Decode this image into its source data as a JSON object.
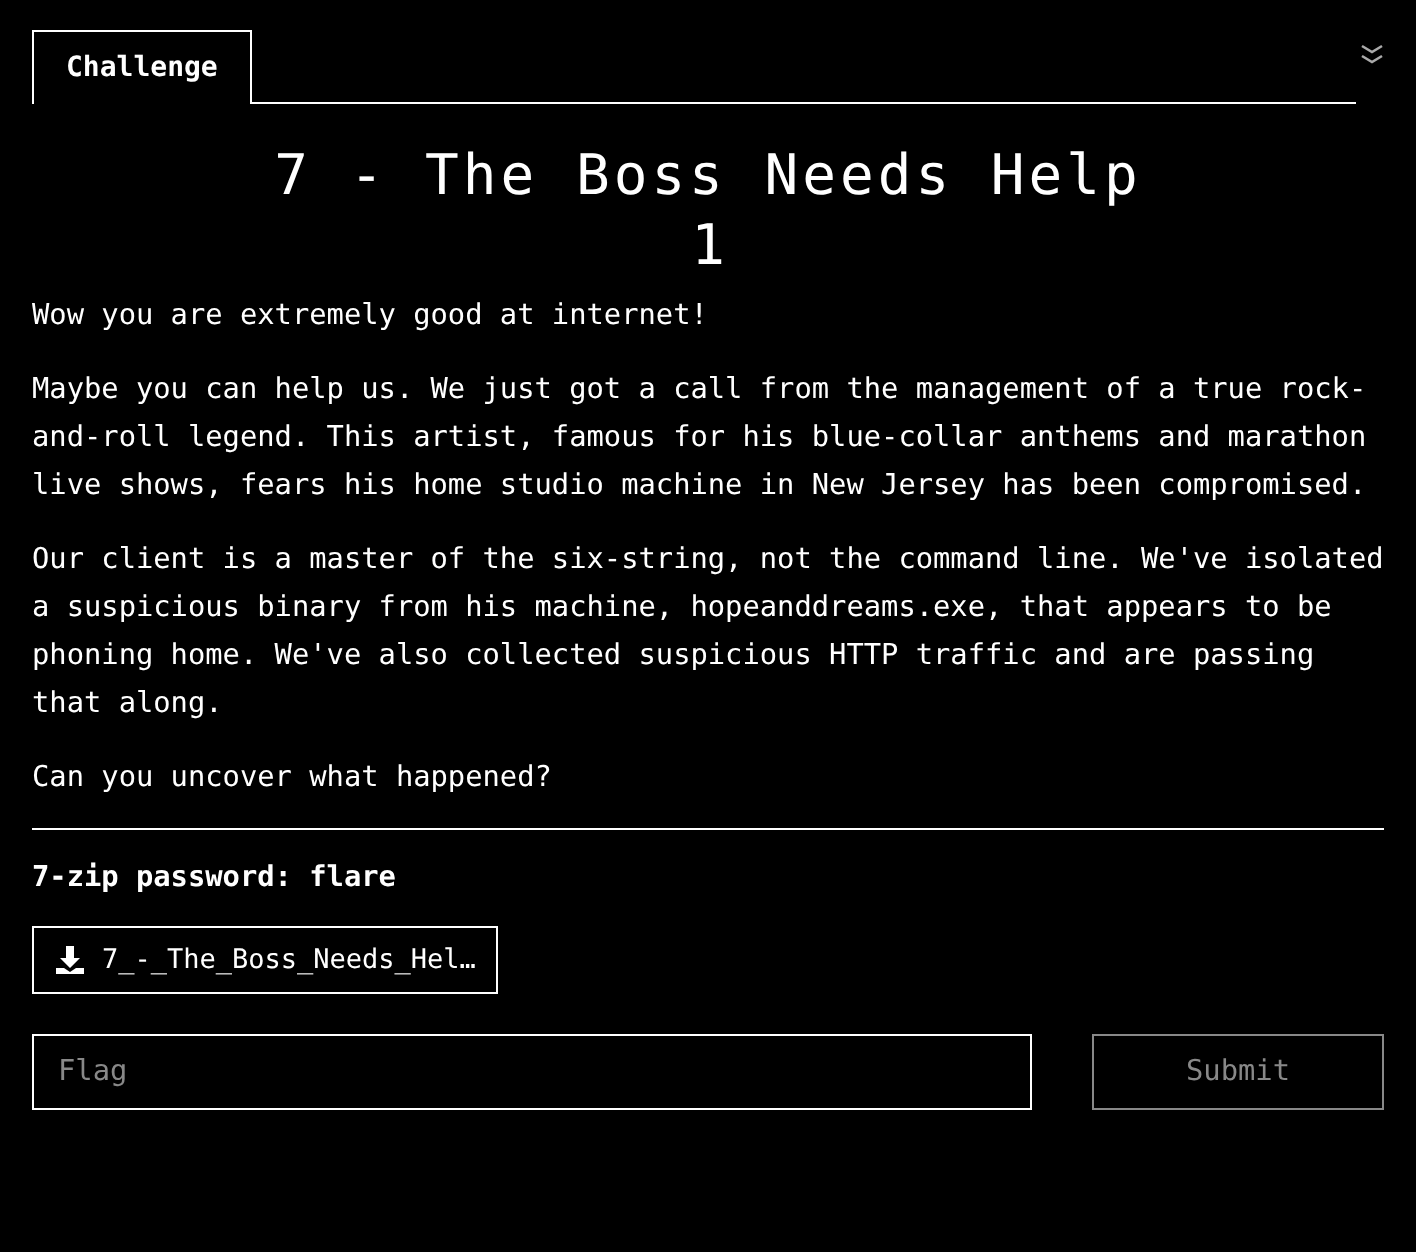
{
  "tabs": [
    {
      "label": "Challenge",
      "selected": true
    }
  ],
  "challenge": {
    "title": "7 - The Boss Needs Help",
    "points": "1",
    "description": [
      "Wow you are extremely good at internet!",
      "Maybe you can help us. We just got a call from the management of a true rock-and-roll legend. This artist, famous for his blue-collar anthems and marathon live shows, fears his home studio machine in New Jersey has been compromised.",
      "Our client is a master of the six-string, not the command line. We've isolated a suspicious binary from his machine, hopeanddreams.exe, that appears to be phoning home. We've also collected suspicious HTTP traffic and are passing that along.",
      "Can you uncover what happened?"
    ],
    "note": "7-zip password: flare",
    "files": [
      "7_-_The_Boss_Needs_Hel…"
    ]
  },
  "flag_form": {
    "placeholder": "Flag",
    "submit": {
      "label": "Submit",
      "disabled": true
    }
  }
}
